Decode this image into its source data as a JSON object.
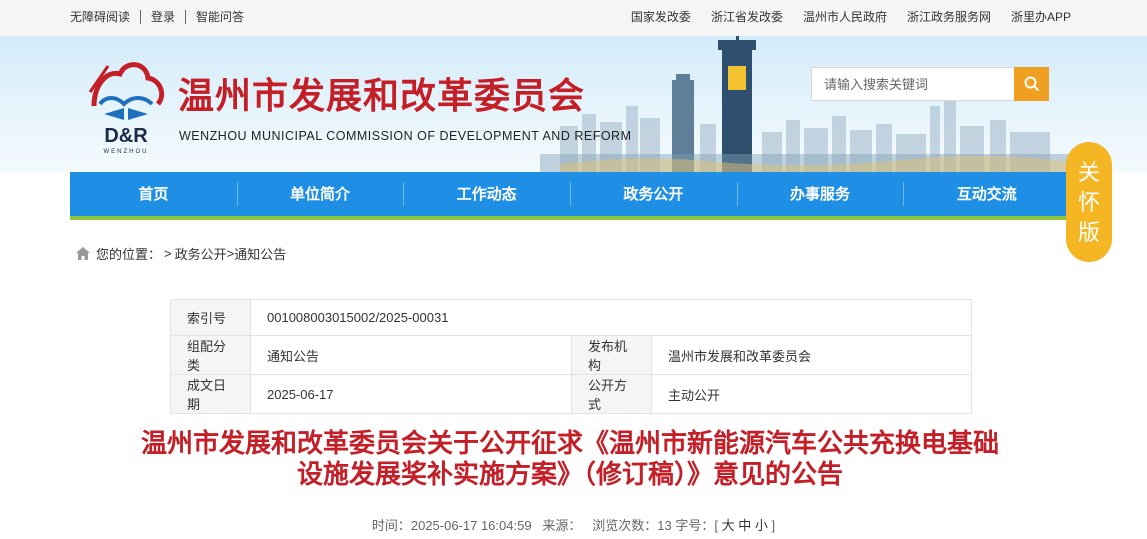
{
  "topbar": {
    "left_links": [
      "无障碍阅读",
      "登录",
      "智能问答"
    ],
    "right_links": [
      "国家发改委",
      "浙江省发改委",
      "温州市人民政府",
      "浙江政务服务网",
      "浙里办APP"
    ]
  },
  "header": {
    "logo_text": "D&R",
    "logo_sub": "WENZHOU",
    "title": "温州市发展和改革委员会",
    "subtitle": "WENZHOU MUNICIPAL COMMISSION OF DEVELOPMENT AND REFORM",
    "search_placeholder": "请输入搜索关键词",
    "search_icon": "search-icon"
  },
  "nav": {
    "items": [
      "首页",
      "单位简介",
      "工作动态",
      "政务公开",
      "办事服务",
      "互动交流"
    ]
  },
  "care_badge": [
    "关",
    "怀",
    "版"
  ],
  "breadcrumb": {
    "icon": "home-icon",
    "label": "您的位置：",
    "sep": ">",
    "items": [
      "政务公开",
      "通知公告"
    ]
  },
  "info": {
    "index_label": "索引号",
    "index_value": "001008003015002/2025-00031",
    "category_label": "组配分类",
    "category_value": "通知公告",
    "publisher_label": "发布机构",
    "publisher_value": "温州市发展和改革委员会",
    "date_label": "成文日期",
    "date_value": "2025-06-17",
    "mode_label": "公开方式",
    "mode_value": "主动公开"
  },
  "article": {
    "title_line1": "温州市发展和改革委员会关于公开征求《温州市新能源汽车公共充换电基础",
    "title_line2": "设施发展奖补实施方案》（修订稿）》意见的公告",
    "time_label": "时间：",
    "time_value": "2025-06-17 16:04:59",
    "source_label": "来源：",
    "views_label": "浏览次数：",
    "views_value": "13",
    "font_label": "字号：",
    "font_sizes": [
      "大",
      "中",
      "小"
    ]
  },
  "colors": {
    "brand_red": "#c41f27",
    "nav_blue": "#1f8fe5",
    "nav_green": "#8cc63f",
    "search_orange": "#f0a020",
    "care_yellow": "#f5b623"
  }
}
